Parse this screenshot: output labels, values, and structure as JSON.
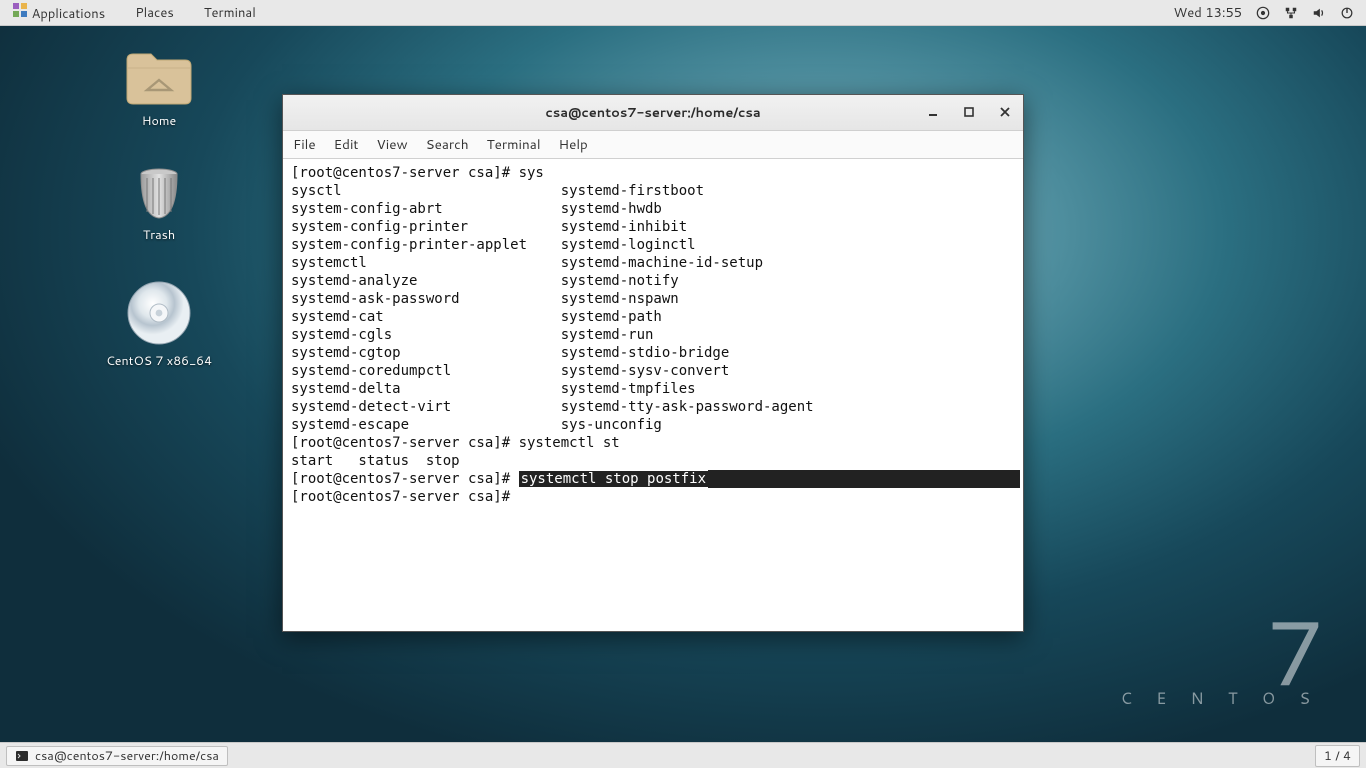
{
  "panel": {
    "menus": {
      "applications": "Applications",
      "places": "Places",
      "terminal": "Terminal"
    },
    "clock": "Wed 13:55"
  },
  "taskbar": {
    "task_label": "csa@centos7-server:/home/csa",
    "workspace": "1 / 4"
  },
  "desktop_icons": {
    "home": "Home",
    "trash": "Trash",
    "disc": "CentOS 7 x86_64"
  },
  "centos_logo": {
    "seven": "7",
    "word": "C E N T O S"
  },
  "window": {
    "title": "csa@centos7-server:/home/csa",
    "menu": {
      "file": "File",
      "edit": "Edit",
      "view": "View",
      "search": "Search",
      "terminal": "Terminal",
      "help": "Help"
    }
  },
  "terminal": {
    "lines": [
      "[root@centos7-server csa]# sys",
      "sysctl                          systemd-firstboot",
      "system-config-abrt              systemd-hwdb",
      "system-config-printer           systemd-inhibit",
      "system-config-printer-applet    systemd-loginctl",
      "systemctl                       systemd-machine-id-setup",
      "systemd-analyze                 systemd-notify",
      "systemd-ask-password            systemd-nspawn",
      "systemd-cat                     systemd-path",
      "systemd-cgls                    systemd-run",
      "systemd-cgtop                   systemd-stdio-bridge",
      "systemd-coredumpctl             systemd-sysv-convert",
      "systemd-delta                   systemd-tmpfiles",
      "systemd-detect-virt             systemd-tty-ask-password-agent",
      "systemd-escape                  sys-unconfig",
      "[root@centos7-server csa]# systemctl st",
      "start   status  stop   "
    ],
    "hl_prompt": "[root@centos7-server csa]# ",
    "hl_cmd": "systemctl stop postfix",
    "after_prompt": "[root@centos7-server csa]# "
  }
}
